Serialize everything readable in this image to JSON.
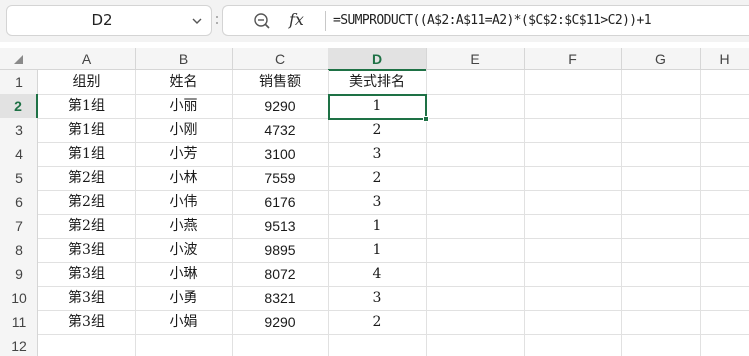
{
  "name_box": {
    "value": "D2"
  },
  "formula_bar": {
    "formula": "=SUMPRODUCT((A$2:A$11=A2)*($C$2:$C$11>C2))+1",
    "fx_label": "fx"
  },
  "columns": [
    "A",
    "B",
    "C",
    "D",
    "E",
    "F",
    "G",
    "H"
  ],
  "rows": [
    "1",
    "2",
    "3",
    "4",
    "5",
    "6",
    "7",
    "8",
    "9",
    "10",
    "11",
    "12"
  ],
  "selected_cell": {
    "column": "D",
    "row": "2"
  },
  "table": {
    "headers": [
      "组别",
      "姓名",
      "销售额",
      "美式排名"
    ],
    "rows": [
      [
        "第1组",
        "小丽",
        "9290",
        "1"
      ],
      [
        "第1组",
        "小刚",
        "4732",
        "2"
      ],
      [
        "第1组",
        "小芳",
        "3100",
        "3"
      ],
      [
        "第2组",
        "小林",
        "7559",
        "2"
      ],
      [
        "第2组",
        "小伟",
        "6176",
        "3"
      ],
      [
        "第2组",
        "小燕",
        "9513",
        "1"
      ],
      [
        "第3组",
        "小波",
        "9895",
        "1"
      ],
      [
        "第3组",
        "小琳",
        "8072",
        "4"
      ],
      [
        "第3组",
        "小勇",
        "8321",
        "3"
      ],
      [
        "第3组",
        "小娟",
        "9290",
        "2"
      ]
    ]
  },
  "colors": {
    "accent": "#1e7145",
    "gridline": "#e1e1e1",
    "header_bg": "#f5f5f5"
  }
}
